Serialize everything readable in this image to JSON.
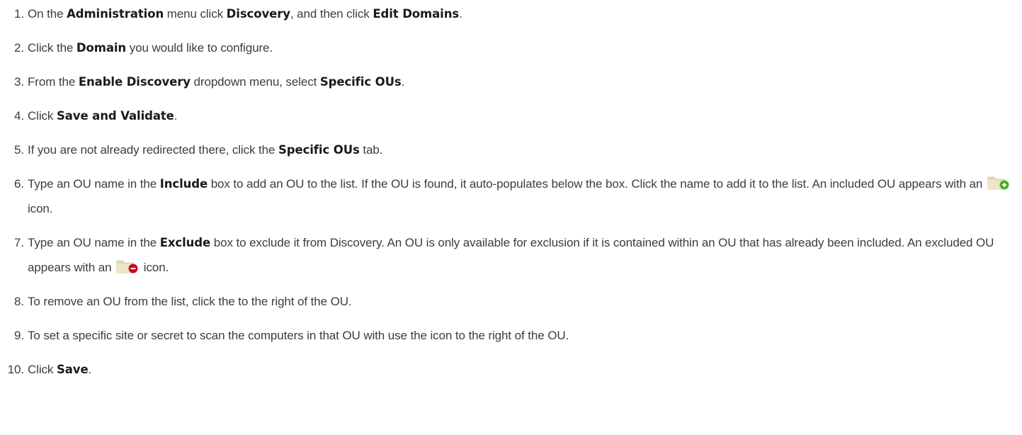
{
  "steps": [
    {
      "num": "1.",
      "parts": [
        "On the ",
        "Administration",
        " menu click ",
        "Discovery",
        ", and then click ",
        "Edit Domains",
        "."
      ]
    },
    {
      "num": "2.",
      "parts": [
        "Click the ",
        "Domain",
        " you would like to configure."
      ]
    },
    {
      "num": "3.",
      "parts": [
        "From the ",
        "Enable Discovery",
        " dropdown menu, select ",
        "Specific OUs",
        "."
      ]
    },
    {
      "num": "4.",
      "parts": [
        "Click ",
        "Save and Validate",
        "."
      ]
    },
    {
      "num": "5.",
      "parts": [
        "If you are not already redirected there, click the ",
        "Specific OUs",
        " tab."
      ]
    },
    {
      "num": "6.",
      "parts": [
        "Type an OU name in the ",
        "Include",
        " box to add an OU to the list. If the OU is found, it auto-populates below the box. Click the name to add it to the list. An included OU appears with an ",
        " icon."
      ]
    },
    {
      "num": "7.",
      "parts": [
        "Type an OU name in the ",
        "Exclude",
        " box to exclude it from Discovery. An OU is only available for exclusion if it is contained within an OU that has already been included. An excluded OU appears with an ",
        " icon."
      ]
    },
    {
      "num": "8.",
      "parts": [
        "To remove an OU from the list, click the to the right of the OU."
      ]
    },
    {
      "num": "9.",
      "parts": [
        "To set a specific site or secret to scan the computers in that OU with use the icon to the right of the OU."
      ]
    },
    {
      "num": "10.",
      "parts": [
        "Click ",
        "Save",
        "."
      ]
    }
  ],
  "icons": {
    "include": "folder-add-icon",
    "exclude": "folder-remove-icon"
  },
  "colors": {
    "text": "#3d3d3d",
    "bold": "#1a1a1a",
    "folder": "#e8dcb8",
    "include_badge": "#4caf20",
    "exclude_badge": "#d0021b"
  }
}
